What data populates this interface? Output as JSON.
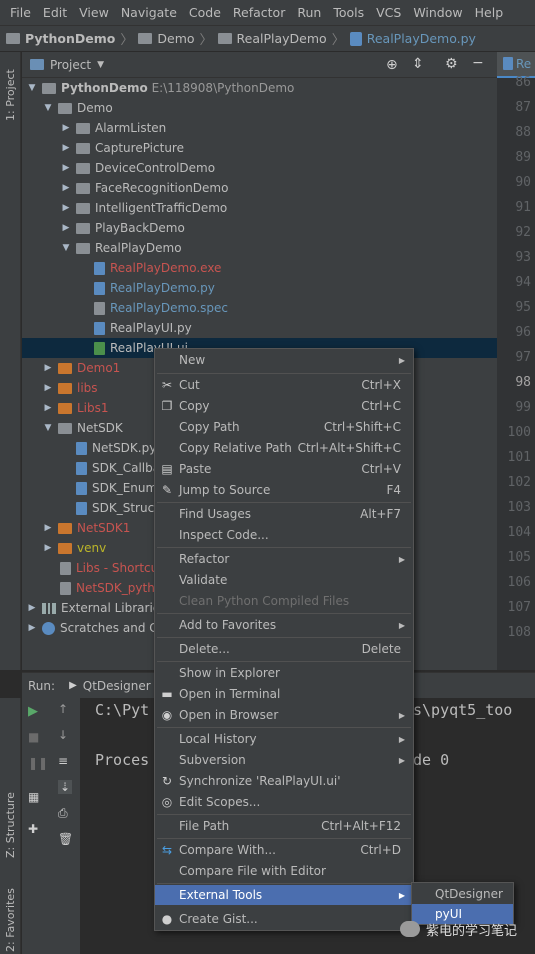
{
  "menubar": [
    "File",
    "Edit",
    "View",
    "Navigate",
    "Code",
    "Refactor",
    "Run",
    "Tools",
    "VCS",
    "Window",
    "Help"
  ],
  "breadcrumb": [
    "PythonDemo",
    "Demo",
    "RealPlayDemo",
    "RealPlayDemo.py"
  ],
  "left_tabs": {
    "project": "1: Project",
    "structure": "Z: Structure",
    "favorites": "2: Favorites"
  },
  "project_header": {
    "title": "Project"
  },
  "editor_tab": "Re",
  "tree": [
    {
      "label": "PythonDemo",
      "extra": "E:\\118908\\PythonDemo"
    },
    {
      "label": "Demo"
    },
    {
      "label": "AlarmListen"
    },
    {
      "label": "CapturePicture"
    },
    {
      "label": "DeviceControlDemo"
    },
    {
      "label": "FaceRecognitionDemo"
    },
    {
      "label": "IntelligentTrafficDemo"
    },
    {
      "label": "PlayBackDemo"
    },
    {
      "label": "RealPlayDemo"
    },
    {
      "label": "RealPlayDemo.exe"
    },
    {
      "label": "RealPlayDemo.py"
    },
    {
      "label": "RealPlayDemo.spec"
    },
    {
      "label": "RealPlayUI.py"
    },
    {
      "label": "RealPlayUI.ui"
    },
    {
      "label": "Demo1"
    },
    {
      "label": "libs"
    },
    {
      "label": "Libs1"
    },
    {
      "label": "NetSDK"
    },
    {
      "label": "NetSDK.py"
    },
    {
      "label": "SDK_Callba"
    },
    {
      "label": "SDK_Enum"
    },
    {
      "label": "SDK_Struct"
    },
    {
      "label": "NetSDK1"
    },
    {
      "label": "venv"
    },
    {
      "label": "Libs - Shortcut"
    },
    {
      "label": "NetSDK_pytho"
    },
    {
      "label": "External Libraries"
    },
    {
      "label": "Scratches and Cor"
    }
  ],
  "line_numbers": [
    "86",
    "87",
    "88",
    "89",
    "90",
    "91",
    "92",
    "93",
    "94",
    "95",
    "96",
    "97",
    "98",
    "99",
    "100",
    "101",
    "102",
    "103",
    "104",
    "105",
    "106",
    "107",
    "108"
  ],
  "run": {
    "label": "Run:",
    "config": "QtDesigner"
  },
  "console": {
    "line1": "C:\\Pyt",
    "line1b": "s\\pyqt5_too",
    "line2": "Proces",
    "line2b": "de 0"
  },
  "context_menu": [
    {
      "label": "New",
      "shortcut": "",
      "submenu": true
    },
    {
      "label": "Cut",
      "shortcut": "Ctrl+X",
      "icon": "✂"
    },
    {
      "label": "Copy",
      "shortcut": "Ctrl+C",
      "icon": "❐"
    },
    {
      "label": "Copy Path",
      "shortcut": "Ctrl+Shift+C"
    },
    {
      "label": "Copy Relative Path",
      "shortcut": "Ctrl+Alt+Shift+C"
    },
    {
      "label": "Paste",
      "shortcut": "Ctrl+V",
      "icon": "▤"
    },
    {
      "label": "Jump to Source",
      "shortcut": "F4",
      "icon": "✎"
    },
    {
      "label": "Find Usages",
      "shortcut": "Alt+F7"
    },
    {
      "label": "Inspect Code...",
      "shortcut": ""
    },
    {
      "label": "Refactor",
      "shortcut": "",
      "submenu": true
    },
    {
      "label": "Validate",
      "shortcut": ""
    },
    {
      "label": "Clean Python Compiled Files",
      "shortcut": "",
      "disabled": true
    },
    {
      "label": "Add to Favorites",
      "shortcut": "",
      "submenu": true
    },
    {
      "label": "Delete...",
      "shortcut": "Delete"
    },
    {
      "label": "Show in Explorer",
      "shortcut": ""
    },
    {
      "label": "Open in Terminal",
      "shortcut": "",
      "icon": "▬"
    },
    {
      "label": "Open in Browser",
      "shortcut": "",
      "submenu": true,
      "icon": "◉"
    },
    {
      "label": "Local History",
      "shortcut": "",
      "submenu": true
    },
    {
      "label": "Subversion",
      "shortcut": "",
      "submenu": true
    },
    {
      "label": "Synchronize 'RealPlayUI.ui'",
      "shortcut": "",
      "icon": "↻"
    },
    {
      "label": "Edit Scopes...",
      "shortcut": "",
      "icon": "◎"
    },
    {
      "label": "File Path",
      "shortcut": "Ctrl+Alt+F12"
    },
    {
      "label": "Compare With...",
      "shortcut": "Ctrl+D",
      "icon": "⇆"
    },
    {
      "label": "Compare File with Editor",
      "shortcut": ""
    },
    {
      "label": "External Tools",
      "shortcut": "",
      "submenu": true,
      "highlighted": true
    },
    {
      "label": "Create Gist...",
      "shortcut": "",
      "icon": "●"
    }
  ],
  "submenu": [
    "QtDesigner",
    "pyUI"
  ],
  "watermark": "紫电的学习笔记"
}
